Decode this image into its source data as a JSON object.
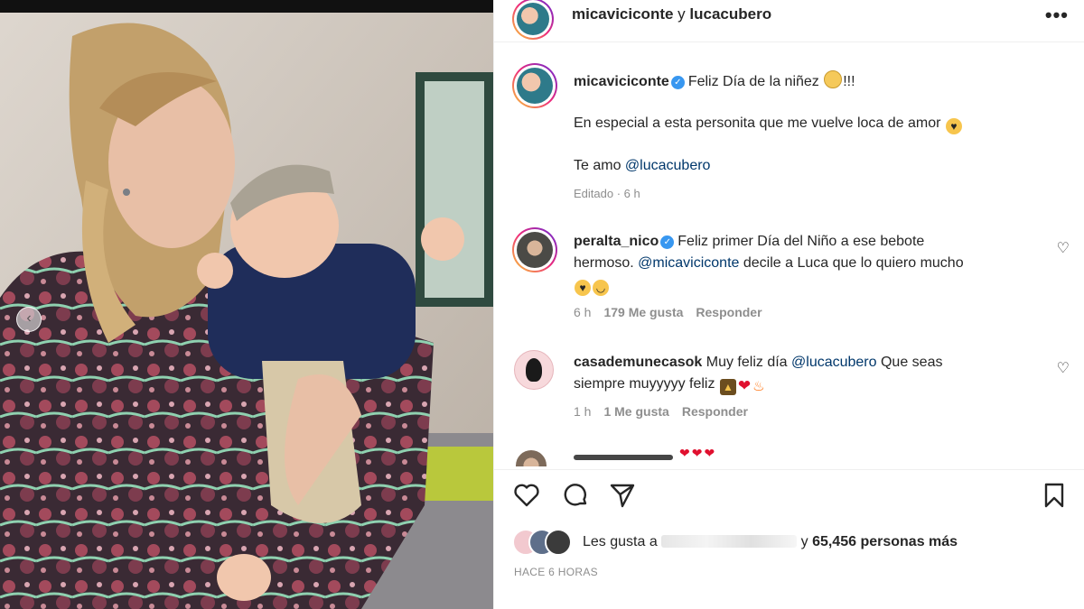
{
  "header": {
    "user1": "micaviciconte",
    "connector": " y ",
    "user2": "lucacubero",
    "more": "•••"
  },
  "caption": {
    "username": "micaviciconte",
    "line1": "Feliz Día de la niñez ",
    "line1_end": "!!!",
    "line2": "En especial a esta personita que me vuelve loca de amor ",
    "line3_prefix": "Te amo ",
    "line3_mention": "@lucacubero",
    "meta": "Editado · 6 h"
  },
  "comments": [
    {
      "username": "peralta_nico",
      "text_a": "Feliz primer Día del Niño a ese bebote",
      "text_b_pre": "hermoso. ",
      "mention": "@micaviciconte",
      "text_b_post": " decile a Luca que lo quiero mucho",
      "time": "6 h",
      "likes": "179 Me gusta",
      "reply": "Responder"
    },
    {
      "username": "casademunecasok",
      "text_pre": " Muy feliz día ",
      "mention": "@lucacubero",
      "text_post": " Que seas",
      "text_line2": "siempre muyyyyy feliz ",
      "time": "1 h",
      "likes": "1 Me gusta",
      "reply": "Responder"
    }
  ],
  "likes": {
    "prefix": "Les gusta a ",
    "suffix": " y ",
    "count": "65,456 personas más"
  },
  "timestamp": "HACE 6 HORAS",
  "icons": [
    "heart-icon",
    "comment-icon",
    "share-icon",
    "bookmark-icon",
    "verified-icon",
    "more-icon"
  ],
  "colors": {
    "verified": "#3897f0",
    "mention": "#00376b",
    "muted": "#8e8e8e",
    "heart": "#e0102f"
  }
}
